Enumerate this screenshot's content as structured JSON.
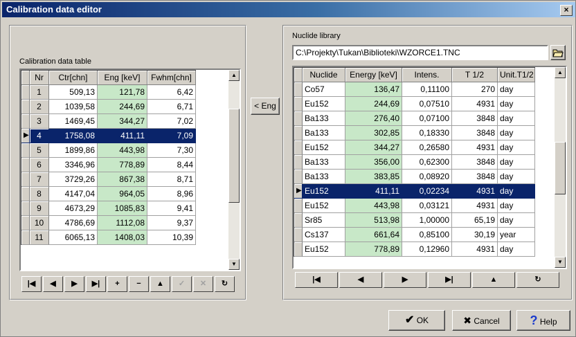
{
  "window": {
    "title": "Calibration data editor",
    "close": "×"
  },
  "calib": {
    "label": "Calibration data table",
    "columns": [
      "Nr",
      "Ctr[chn]",
      "Eng [keV]",
      "Fwhm[chn]"
    ],
    "rows": [
      {
        "nr": "1",
        "ctr": "509,13",
        "eng": "121,78",
        "fwhm": "6,42"
      },
      {
        "nr": "2",
        "ctr": "1039,58",
        "eng": "244,69",
        "fwhm": "6,71"
      },
      {
        "nr": "3",
        "ctr": "1469,45",
        "eng": "344,27",
        "fwhm": "7,02"
      },
      {
        "nr": "4",
        "ctr": "1758,08",
        "eng": "411,11",
        "fwhm": "7,09"
      },
      {
        "nr": "5",
        "ctr": "1899,86",
        "eng": "443,98",
        "fwhm": "7,30"
      },
      {
        "nr": "6",
        "ctr": "3346,96",
        "eng": "778,89",
        "fwhm": "8,44"
      },
      {
        "nr": "7",
        "ctr": "3729,26",
        "eng": "867,38",
        "fwhm": "8,71"
      },
      {
        "nr": "8",
        "ctr": "4147,04",
        "eng": "964,05",
        "fwhm": "8,96"
      },
      {
        "nr": "9",
        "ctr": "4673,29",
        "eng": "1085,83",
        "fwhm": "9,41"
      },
      {
        "nr": "10",
        "ctr": "4786,69",
        "eng": "1112,08",
        "fwhm": "9,37"
      },
      {
        "nr": "11",
        "ctr": "6065,13",
        "eng": "1408,03",
        "fwhm": "10,39"
      }
    ],
    "selected_index": 3,
    "nav": [
      {
        "name": "first-record-button",
        "glyph": "|◀",
        "dis": false
      },
      {
        "name": "prior-record-button",
        "glyph": "◀",
        "dis": false
      },
      {
        "name": "next-record-button",
        "glyph": "▶",
        "dis": false
      },
      {
        "name": "last-record-button",
        "glyph": "▶|",
        "dis": false
      },
      {
        "name": "insert-record-button",
        "glyph": "+",
        "dis": false
      },
      {
        "name": "delete-record-button",
        "glyph": "−",
        "dis": false
      },
      {
        "name": "edit-record-button",
        "glyph": "▲",
        "dis": false
      },
      {
        "name": "post-record-button",
        "glyph": "✓",
        "dis": true
      },
      {
        "name": "cancel-edit-button",
        "glyph": "✕",
        "dis": true
      },
      {
        "name": "refresh-button",
        "glyph": "↻",
        "dis": false
      }
    ]
  },
  "eng_button": "< Eng",
  "library": {
    "label": "Nuclide library",
    "path": "C:\\Projekty\\Tukan\\Biblioteki\\WZORCE1.TNC",
    "columns": [
      "Nuclide",
      "Energy [keV]",
      "Intens.",
      "T 1/2",
      "Unit.T1/2"
    ],
    "rows": [
      {
        "nuc": "Co57",
        "en": "136,47",
        "int": "0,11100",
        "t": "270",
        "u": "day"
      },
      {
        "nuc": "Eu152",
        "en": "244,69",
        "int": "0,07510",
        "t": "4931",
        "u": "day"
      },
      {
        "nuc": "Ba133",
        "en": "276,40",
        "int": "0,07100",
        "t": "3848",
        "u": "day"
      },
      {
        "nuc": "Ba133",
        "en": "302,85",
        "int": "0,18330",
        "t": "3848",
        "u": "day"
      },
      {
        "nuc": "Eu152",
        "en": "344,27",
        "int": "0,26580",
        "t": "4931",
        "u": "day"
      },
      {
        "nuc": "Ba133",
        "en": "356,00",
        "int": "0,62300",
        "t": "3848",
        "u": "day"
      },
      {
        "nuc": "Ba133",
        "en": "383,85",
        "int": "0,08920",
        "t": "3848",
        "u": "day"
      },
      {
        "nuc": "Eu152",
        "en": "411,11",
        "int": "0,02234",
        "t": "4931",
        "u": "day"
      },
      {
        "nuc": "Eu152",
        "en": "443,98",
        "int": "0,03121",
        "t": "4931",
        "u": "day"
      },
      {
        "nuc": "Sr85",
        "en": "513,98",
        "int": "1,00000",
        "t": "65,19",
        "u": "day"
      },
      {
        "nuc": "Cs137",
        "en": "661,64",
        "int": "0,85100",
        "t": "30,19",
        "u": "year"
      },
      {
        "nuc": "Eu152",
        "en": "778,89",
        "int": "0,12960",
        "t": "4931",
        "u": "day"
      }
    ],
    "selected_index": 7,
    "nav": [
      {
        "name": "lib-first-button",
        "glyph": "|◀"
      },
      {
        "name": "lib-prior-button",
        "glyph": "◀"
      },
      {
        "name": "lib-next-button",
        "glyph": "▶"
      },
      {
        "name": "lib-last-button",
        "glyph": "▶|"
      },
      {
        "name": "lib-edit-button",
        "glyph": "▲"
      },
      {
        "name": "lib-refresh-button",
        "glyph": "↻"
      }
    ]
  },
  "buttons": {
    "ok": "OK",
    "cancel": "Cancel",
    "help": "Help",
    "ok_icon": "✔",
    "cancel_icon": "✖",
    "help_icon": "?"
  },
  "colors": {
    "selection": "#0a246a",
    "energy_col": "#c8e8c8",
    "help_icon": "#1a3acc"
  },
  "icons": {
    "open_folder": "open-folder-icon",
    "row_indicator": "▶"
  }
}
